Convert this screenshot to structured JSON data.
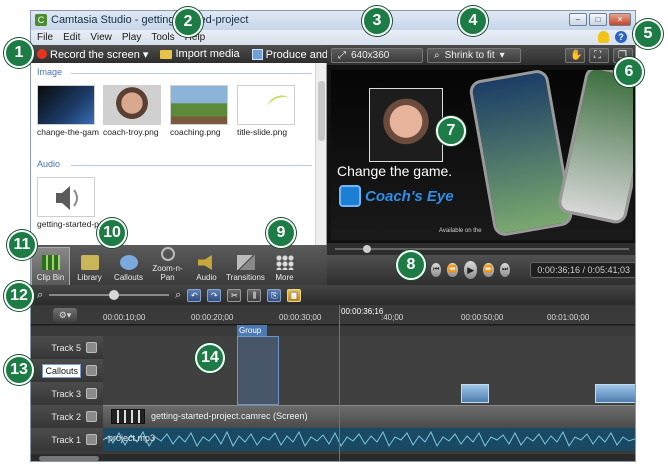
{
  "window": {
    "title": "Camtasia Studio - getting-started-project"
  },
  "menu": [
    "File",
    "Edit",
    "View",
    "Play",
    "Tools",
    "Help"
  ],
  "toolbar": {
    "record": "Record the screen ▾",
    "import": "Import media",
    "produce": "Produce and share ▾"
  },
  "clipbin": {
    "image_section": "Image",
    "audio_section": "Audio",
    "images": [
      {
        "name": "change-the-game..."
      },
      {
        "name": "coach-troy.png"
      },
      {
        "name": "coaching.png"
      },
      {
        "name": "title-slide.png"
      }
    ],
    "audio": [
      {
        "name": "getting-started-pr..."
      }
    ]
  },
  "tabs": [
    {
      "label": "Clip Bin"
    },
    {
      "label": "Library"
    },
    {
      "label": "Callouts"
    },
    {
      "label": "Zoom-n-Pan"
    },
    {
      "label": "Audio"
    },
    {
      "label": "Transitions"
    },
    {
      "label": "More"
    }
  ],
  "preview": {
    "dimensions": "640x360",
    "zoom": "Shrink to fit",
    "tagline": "Change the game.",
    "brand": "Coach's Eye",
    "available": "Available on the"
  },
  "playback": {
    "time": "0:00:36;16 / 0:05:41;03"
  },
  "timeline": {
    "ruler": [
      "00:00:10;00",
      "00:00:20;00",
      "00:00:30;00",
      ":40;00",
      "00:00:50;00",
      "00:01:00;00"
    ],
    "playhead": "00:00:36;16",
    "group_label": "Group",
    "tracks": [
      {
        "label": "Track 5"
      },
      {
        "label": "Callouts"
      },
      {
        "label": "Track 3"
      },
      {
        "label": "Track 2"
      },
      {
        "label": "Track 1"
      }
    ],
    "screen_clip": "getting-started-project.camrec (Screen)",
    "audio_clip": "-project.mp3"
  },
  "callouts": [
    "1",
    "2",
    "3",
    "4",
    "5",
    "6",
    "7",
    "8",
    "9",
    "10",
    "11",
    "12",
    "13",
    "14"
  ],
  "colors": {
    "badge": "#1d7c45",
    "accent": "#4b79b0",
    "record": "#e53420"
  }
}
